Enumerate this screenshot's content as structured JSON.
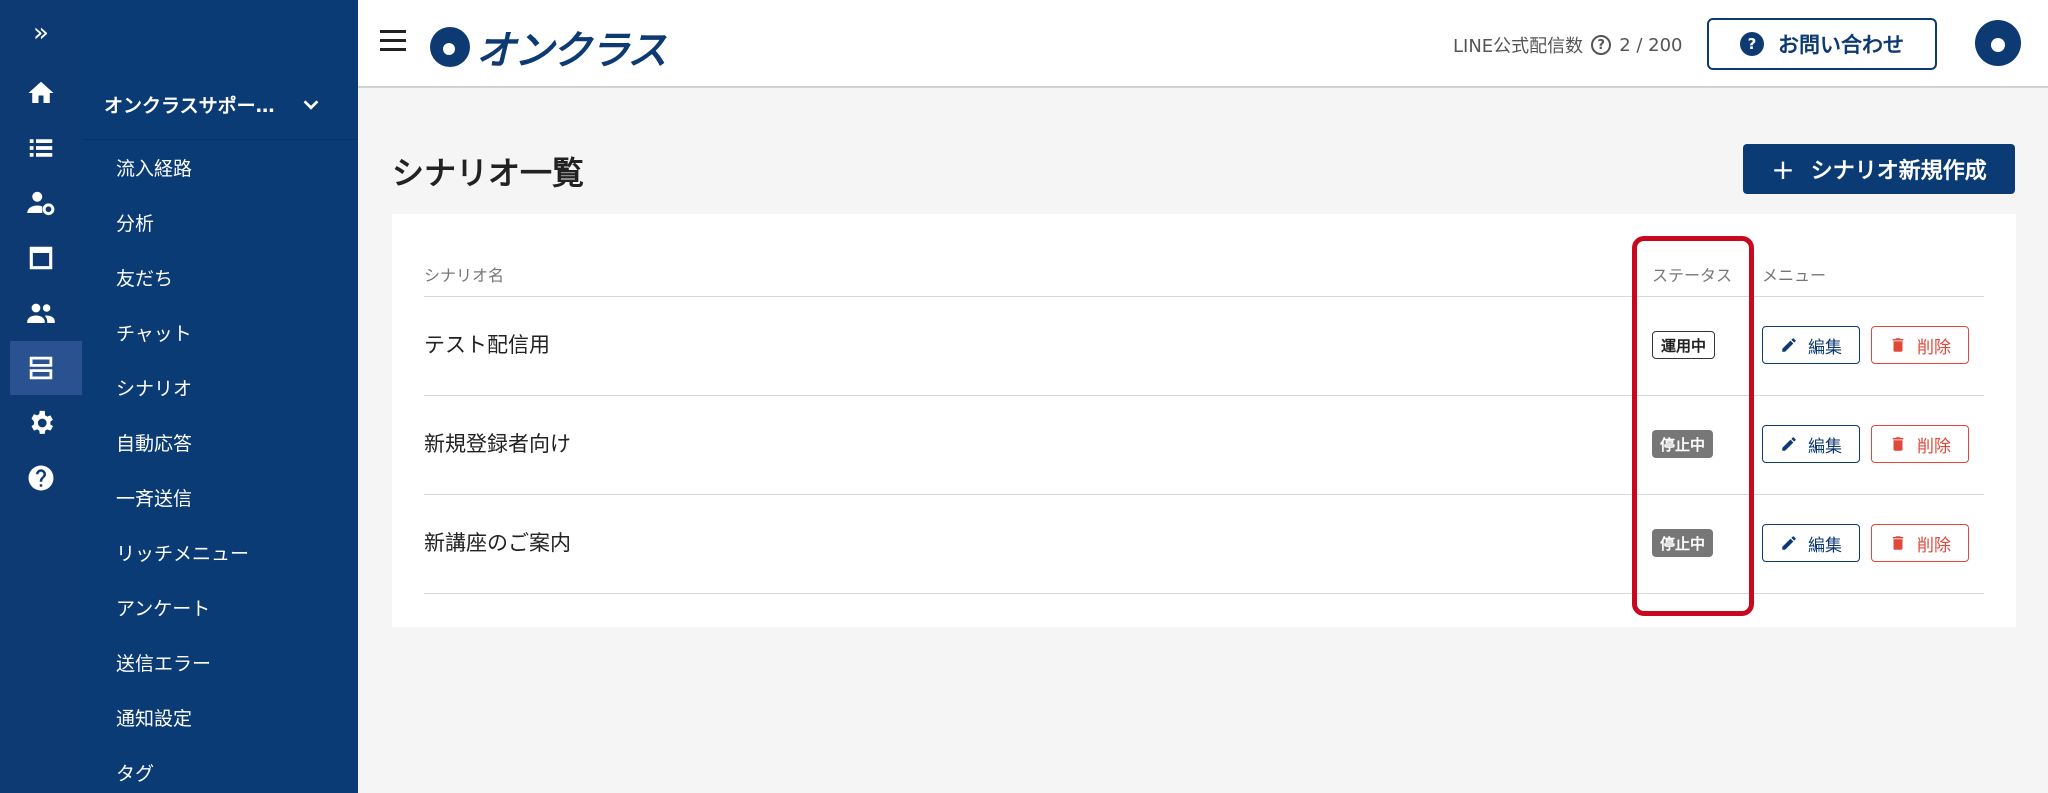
{
  "rail": {
    "toggle_label": "»",
    "icons": [
      "home-icon",
      "list-icon",
      "user-settings-icon",
      "window-icon",
      "people-icon",
      "scenario-icon",
      "gear-icon",
      "help-icon"
    ],
    "active_index": 5
  },
  "subnav": {
    "account_label": "オンクラスサポー…",
    "items": [
      {
        "label": "流入経路"
      },
      {
        "label": "分析"
      },
      {
        "label": "友だち"
      },
      {
        "label": "チャット"
      },
      {
        "label": "シナリオ"
      },
      {
        "label": "自動応答"
      },
      {
        "label": "一斉送信"
      },
      {
        "label": "リッチメニュー"
      },
      {
        "label": "アンケート"
      },
      {
        "label": "送信エラー"
      },
      {
        "label": "通知設定"
      },
      {
        "label": "タグ"
      }
    ]
  },
  "topbar": {
    "logo_text": "オンクラス",
    "quota_label": "LINE公式配信数",
    "quota_help": "?",
    "quota_value": "2 / 200",
    "contact_icon": "?",
    "contact_label": "お問い合わせ"
  },
  "page": {
    "title": "シナリオ一覧",
    "create_label": "シナリオ新規作成",
    "create_icon": "+"
  },
  "table": {
    "headers": {
      "name": "シナリオ名",
      "status": "ステータス",
      "menu": "メニュー"
    },
    "rows": [
      {
        "name": "テスト配信用",
        "status": "運用中",
        "status_type": "on",
        "edit": "編集",
        "delete": "削除"
      },
      {
        "name": "新規登録者向け",
        "status": "停止中",
        "status_type": "off",
        "edit": "編集",
        "delete": "削除"
      },
      {
        "name": "新講座のご案内",
        "status": "停止中",
        "status_type": "off",
        "edit": "編集",
        "delete": "削除"
      }
    ]
  },
  "colors": {
    "brand": "#0d3a72",
    "danger": "#e0483a",
    "highlight": "#c8081e"
  }
}
